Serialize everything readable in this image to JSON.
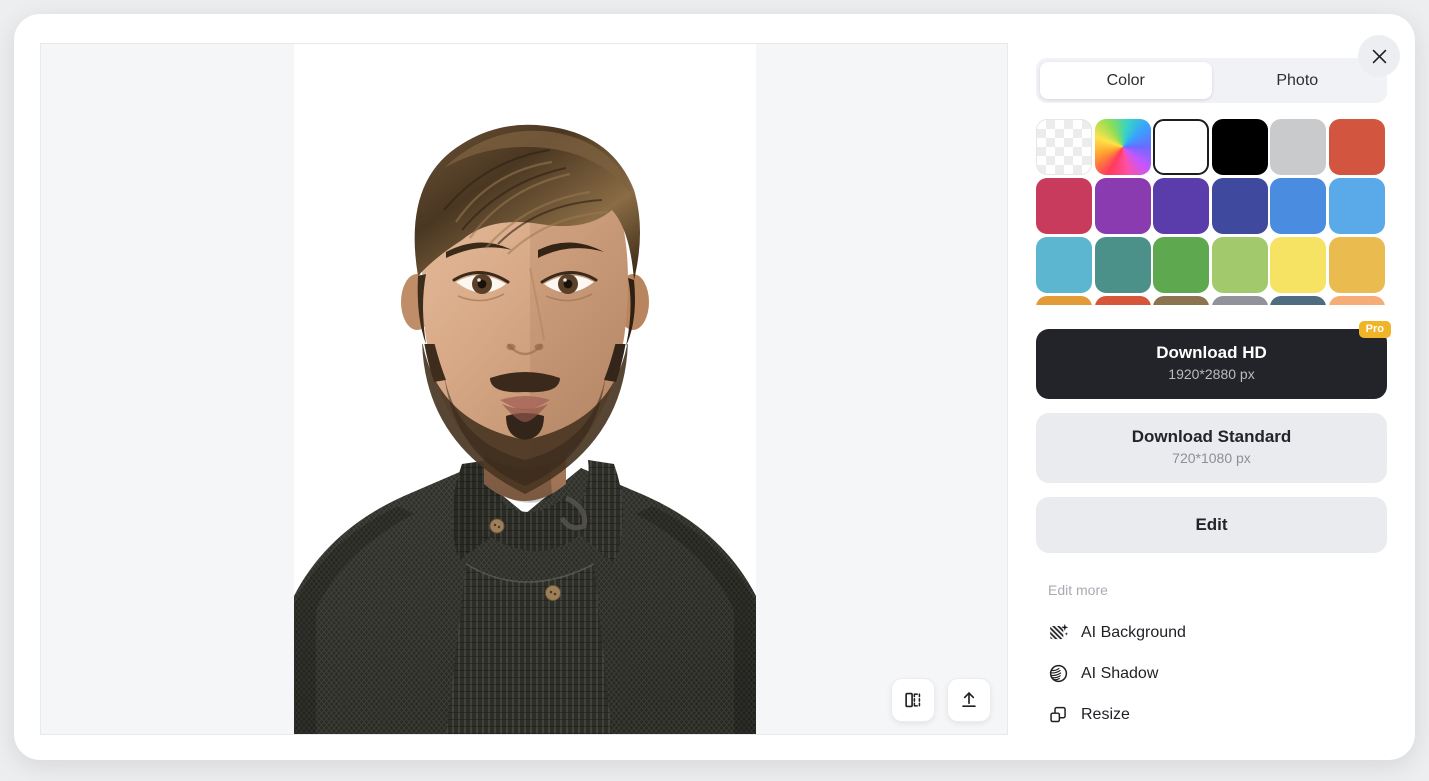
{
  "modal": {
    "close_label": "Close",
    "close_icon": "close-icon"
  },
  "canvas": {
    "tools": [
      {
        "name": "compare-toggle",
        "icon": "compare-split-icon",
        "label": "Compare original"
      },
      {
        "name": "upload",
        "icon": "upload-arrow-icon",
        "label": "Upload new image"
      }
    ],
    "image": {
      "alt": "Portrait of a bearded man in a dark charcoal knit shawl-collar sweater on a white background",
      "background": "#ffffff"
    }
  },
  "sidebar": {
    "tabs": [
      {
        "label": "Color",
        "active": true
      },
      {
        "label": "Photo",
        "active": false
      }
    ],
    "swatches": [
      {
        "name": "transparent",
        "type": "transparent",
        "color": "",
        "selected": false
      },
      {
        "name": "custom-picker",
        "type": "rainbow",
        "color": "",
        "selected": false
      },
      {
        "name": "white",
        "type": "solid",
        "color": "#ffffff",
        "selected": true
      },
      {
        "name": "black",
        "type": "solid",
        "color": "#000000",
        "selected": false
      },
      {
        "name": "light-gray",
        "type": "solid",
        "color": "#c9cacc",
        "selected": false
      },
      {
        "name": "brick-red",
        "type": "solid",
        "color": "#d2553f",
        "selected": false
      },
      {
        "name": "crimson",
        "type": "solid",
        "color": "#c93b5c",
        "selected": false
      },
      {
        "name": "purple",
        "type": "solid",
        "color": "#8b3bb0",
        "selected": false
      },
      {
        "name": "violet",
        "type": "solid",
        "color": "#5b3cab",
        "selected": false
      },
      {
        "name": "indigo",
        "type": "solid",
        "color": "#3f4a9e",
        "selected": false
      },
      {
        "name": "blue",
        "type": "solid",
        "color": "#4a8de0",
        "selected": false
      },
      {
        "name": "sky-blue",
        "type": "solid",
        "color": "#5aa9e8",
        "selected": false
      },
      {
        "name": "cyan",
        "type": "solid",
        "color": "#5cb6cf",
        "selected": false
      },
      {
        "name": "teal",
        "type": "solid",
        "color": "#4c9189",
        "selected": false
      },
      {
        "name": "green",
        "type": "solid",
        "color": "#5ea84f",
        "selected": false
      },
      {
        "name": "light-green",
        "type": "solid",
        "color": "#a2c96b",
        "selected": false
      },
      {
        "name": "yellow",
        "type": "solid",
        "color": "#f6e364",
        "selected": false
      },
      {
        "name": "amber",
        "type": "solid",
        "color": "#eabb4e",
        "selected": false
      },
      {
        "name": "orange",
        "type": "solid",
        "color": "#e39a38",
        "selected": false
      },
      {
        "name": "burnt-orange",
        "type": "solid",
        "color": "#d6563a",
        "selected": false
      },
      {
        "name": "tan",
        "type": "solid",
        "color": "#8c7450",
        "selected": false
      },
      {
        "name": "gray",
        "type": "solid",
        "color": "#92939a",
        "selected": false
      },
      {
        "name": "slate",
        "type": "solid",
        "color": "#4e6b7f",
        "selected": false
      },
      {
        "name": "peach",
        "type": "solid",
        "color": "#f5ac77",
        "selected": false
      }
    ],
    "download_hd": {
      "title": "Download HD",
      "subtitle": "1920*2880 px",
      "badge": "Pro"
    },
    "download_standard": {
      "title": "Download Standard",
      "subtitle": "720*1080 px"
    },
    "edit_button": "Edit",
    "edit_more_label": "Edit more",
    "edit_more_items": [
      {
        "label": "AI Background",
        "icon": "ai-background-icon"
      },
      {
        "label": "AI Shadow",
        "icon": "ai-shadow-icon"
      },
      {
        "label": "Resize",
        "icon": "resize-icon"
      }
    ]
  }
}
